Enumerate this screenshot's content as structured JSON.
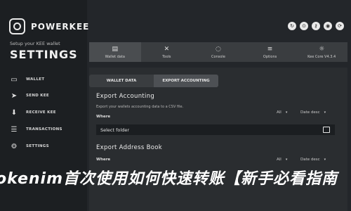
{
  "brand": {
    "name": "POWERKEE"
  },
  "setup": {
    "subtitle": "Setup your KEE wallet",
    "title": "SETTINGS"
  },
  "sidebar": {
    "items": [
      {
        "label": "WALLET",
        "icon": "wallet-icon",
        "glyph": "▭"
      },
      {
        "label": "SEND KEE",
        "icon": "send-icon",
        "glyph": "➤"
      },
      {
        "label": "RECEIVE KEE",
        "icon": "receive-icon",
        "glyph": "⬇"
      },
      {
        "label": "TRANSACTIONS",
        "icon": "transactions-icon",
        "glyph": "☰"
      },
      {
        "label": "SETTINGS",
        "icon": "settings-icon",
        "glyph": "⚙"
      }
    ]
  },
  "top_icons": [
    {
      "icon": "refresh-icon",
      "glyph": "↻"
    },
    {
      "icon": "lock-icon",
      "glyph": "⊙"
    },
    {
      "icon": "key-icon",
      "glyph": "⚷"
    },
    {
      "icon": "network-icon",
      "glyph": "◉"
    },
    {
      "icon": "sync-icon",
      "glyph": "⟳"
    }
  ],
  "tabs": [
    {
      "label": "Wallet data",
      "icon": "database-icon",
      "glyph": "▤"
    },
    {
      "label": "Tools",
      "icon": "tools-icon",
      "glyph": "✕"
    },
    {
      "label": "Console",
      "icon": "console-icon",
      "glyph": "◌"
    },
    {
      "label": "Options",
      "icon": "options-icon",
      "glyph": "≡"
    },
    {
      "label": "Kee Core V4.3.4",
      "icon": "core-icon",
      "glyph": "☼"
    }
  ],
  "subtabs": {
    "wallet_data": "WALLET DATA",
    "export_accounting": "EXPORT ACCOUNTING"
  },
  "export_accounting": {
    "title": "Export Accounting",
    "description": "Export your wallets accounting data to a CSV file.",
    "where_label": "Where",
    "filter_value": "All",
    "sort_value": "Date desc",
    "folder_placeholder": "Select folder"
  },
  "export_address_book": {
    "title": "Export Address Book",
    "where_label": "Where",
    "filter_value": "All",
    "sort_value": "Date desc"
  },
  "overlay": {
    "text": "okenim首次使用如何快速转账【新手必看指南"
  }
}
